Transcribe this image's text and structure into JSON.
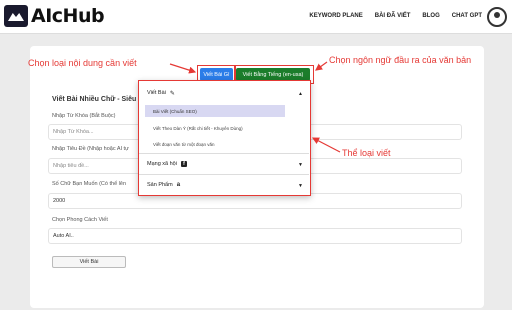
{
  "header": {
    "logo_text": "AIcHub",
    "nav": [
      "KEYWORD PLANE",
      "BÀI ĐÃ VIẾT",
      "BLOG",
      "CHAT GPT"
    ]
  },
  "toolbar": {
    "type_button": "Viết Bài Gì",
    "language_button": "Viết Bằng Tiếng (en-usa)"
  },
  "form": {
    "title": "Viết Bài Nhiều Chữ - Siêu",
    "keyword_label": "Nhập Từ Khóa (Bắt Buộc)",
    "keyword_placeholder": "Nhập Từ Khóa...",
    "title_label": "Nhập Tiêu Đề (Nhập hoặc AI tự",
    "title_placeholder": "Nhập tiêu đề...",
    "wordcount_label": "Số Chữ Bạn Muốn (Có thể lên",
    "wordcount_value": "2000",
    "style_label": "Chọn Phong Cách Viết",
    "style_value": "Auto AI..",
    "submit_label": "Viết Bài"
  },
  "dropdown": {
    "groups": [
      {
        "label": "Viết Bài",
        "icon": "edit-icon",
        "expanded": true,
        "items": [
          {
            "label": "Bài Viết (Chuẩn SEO)",
            "selected": true
          },
          {
            "label": "Viết Theo Dàn Ý (Rất chi tiết - Khuyên Dùng)",
            "selected": false
          },
          {
            "label": "Viết đoạn văn từ một đoạn văn",
            "selected": false
          }
        ]
      },
      {
        "label": "Mạng xã hội",
        "icon": "facebook-icon",
        "expanded": false,
        "items": []
      },
      {
        "label": "Sản Phẩm",
        "icon": "amazon-icon",
        "expanded": false,
        "items": []
      }
    ]
  },
  "annotations": {
    "choose_type": "Chọn loại nội dung cần viết",
    "choose_language": "Chọn ngôn ngữ đầu ra của văn bản",
    "genre": "Thể loại viết"
  },
  "colors": {
    "annotation_red": "#e53935",
    "blue_button": "#2b7de9",
    "green_button": "#1b7d2b",
    "selected_item": "#d8d8f2"
  }
}
